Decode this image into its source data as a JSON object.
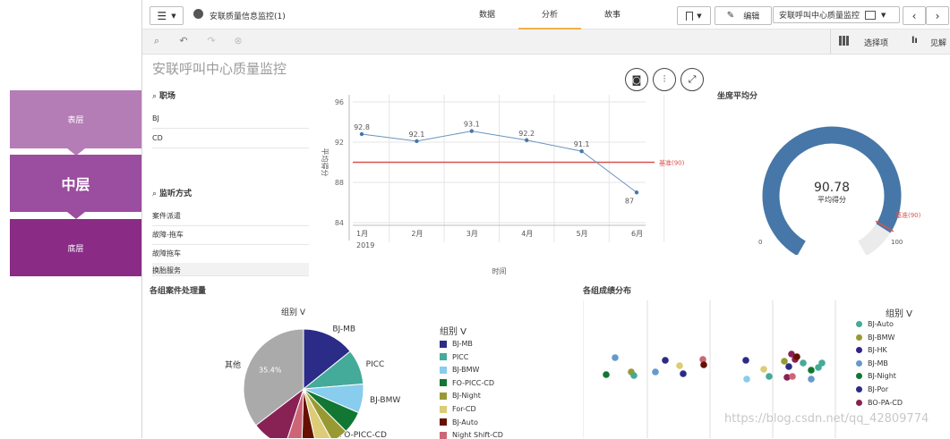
{
  "layers": {
    "top": "表层",
    "middle": "中层",
    "bottom": "底层"
  },
  "topbar": {
    "menu_icon": "hamburger-icon",
    "app_name": "安联质量信息监控(1)",
    "tabs": [
      {
        "label": "数据",
        "active": false
      },
      {
        "label": "分析",
        "active": true
      },
      {
        "label": "故事",
        "active": false
      }
    ],
    "edit_label": "编辑",
    "sheet_name": "安联呼叫中心质量监控"
  },
  "toolbar": {
    "selections_label": "选择项",
    "insights_label": "见解"
  },
  "sheet": {
    "title": "安联呼叫中心质量监控"
  },
  "filters": [
    {
      "title": "职场",
      "items": [
        "BJ",
        "CD"
      ]
    },
    {
      "title": "监听方式",
      "items": [
        "案件派遣",
        "故障-拖车",
        "故障拖车",
        "换胎服务"
      ]
    }
  ],
  "line_chart": {
    "chart_data": {
      "type": "line",
      "categories": [
        "1月",
        "2月",
        "3月",
        "4月",
        "5月",
        "6月"
      ],
      "values": [
        92.8,
        92.1,
        93.1,
        92.2,
        91.1,
        87
      ],
      "x_sub_label": "2019",
      "xlabel": "时间",
      "ylabel": "平均得分",
      "yticks": [
        "96",
        "92",
        "88",
        "84"
      ],
      "ylim": [
        84,
        96
      ],
      "reference": {
        "label": "基准(90)",
        "value": 90
      },
      "colors": {
        "line": "#6a93c0",
        "reference": "#d9534f"
      }
    }
  },
  "gauge": {
    "title": "坐席平均分",
    "chart_data": {
      "type": "gauge",
      "value": 90.78,
      "value_label": "90.78",
      "label": "平均得分",
      "min_label": "0",
      "max_label": "100",
      "reference_label": "基准(90)",
      "color": "#4677a8"
    }
  },
  "pie": {
    "section_title": "各组案件处理量",
    "dimension_label": "组别 V",
    "chart_data": {
      "type": "pie",
      "slices": [
        {
          "label": "BJ-MB",
          "color": "#2b2b88"
        },
        {
          "label": "PICC",
          "color": "#44aa99"
        },
        {
          "label": "BJ-BMW",
          "color": "#88ccee"
        },
        {
          "label": "FO-PICC-CD",
          "color": "#117733"
        },
        {
          "label": "BJ-Night",
          "color": "#999933"
        },
        {
          "label": "For-CD",
          "color": "#ddcc77"
        },
        {
          "label": "BJ-Auto",
          "color": "#661100"
        },
        {
          "label": "Night Shift-CD",
          "color": "#cc6677"
        },
        {
          "label": "",
          "color": "#882255"
        },
        {
          "label": "其他",
          "color": "#aaaaaa",
          "value_label": "35.4%"
        }
      ]
    },
    "legend": [
      {
        "label": "BJ-MB",
        "color": "#2b2b88"
      },
      {
        "label": "PICC",
        "color": "#44aa99"
      },
      {
        "label": "BJ-BMW",
        "color": "#88ccee"
      },
      {
        "label": "FO-PICC-CD",
        "color": "#117733"
      },
      {
        "label": "BJ-Night",
        "color": "#999933"
      },
      {
        "label": "For-CD",
        "color": "#ddcc77"
      },
      {
        "label": "BJ-Auto",
        "color": "#661100"
      },
      {
        "label": "Night Shift-CD",
        "color": "#cc6677"
      }
    ]
  },
  "scatter": {
    "section_title": "各组成绩分布",
    "legend_title": "组别 V",
    "legend": [
      {
        "label": "BJ-Auto",
        "color": "#44aa99"
      },
      {
        "label": "BJ-BMW",
        "color": "#999933"
      },
      {
        "label": "BJ-HK",
        "color": "#332288"
      },
      {
        "label": "BJ-MB",
        "color": "#6699cc"
      },
      {
        "label": "BJ-Night",
        "color": "#117733"
      },
      {
        "label": "BJ-Por",
        "color": "#2b2b88"
      },
      {
        "label": "BO-PA-CD",
        "color": "#882255"
      }
    ]
  },
  "watermark": "https://blog.csdn.net/qq_42809774"
}
